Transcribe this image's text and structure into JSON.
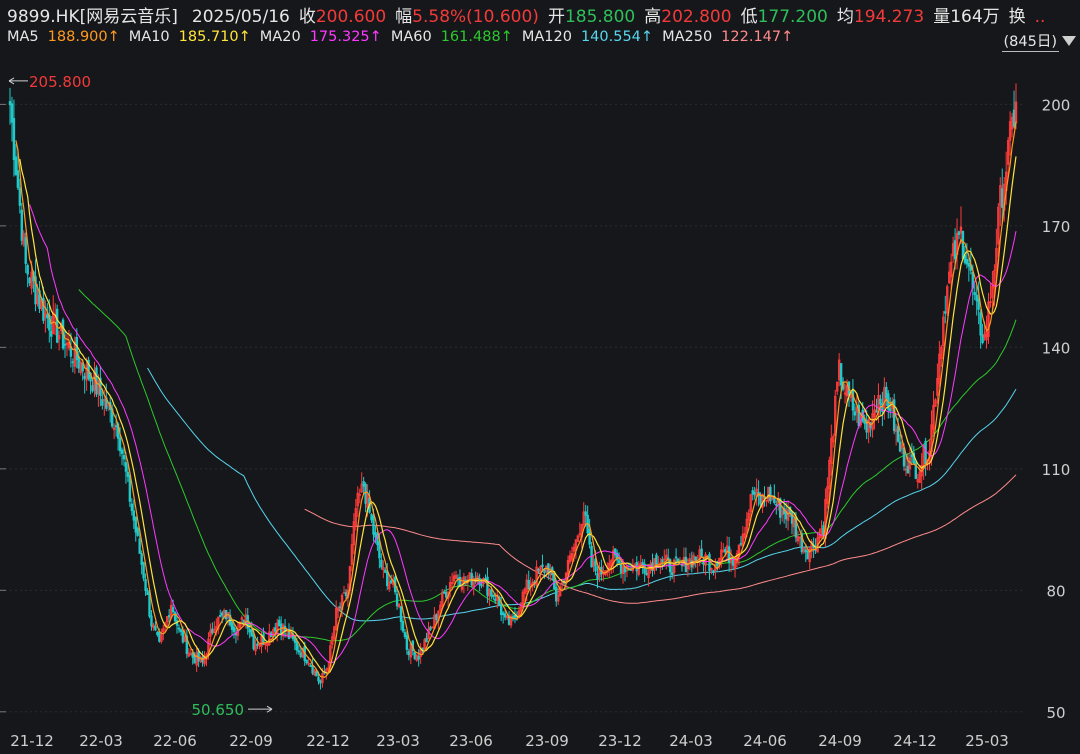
{
  "quote": {
    "symbol": "9899.HK[网易云音乐]",
    "date": "2025/05/16",
    "close_label": "收",
    "close": "200.600",
    "change_label": "幅",
    "change": "5.58%(10.600)",
    "open_label": "开",
    "open": "185.800",
    "high_label": "高",
    "high": "202.800",
    "low_label": "低",
    "low": "177.200",
    "avg_label": "均",
    "avg": "194.273",
    "volume_label": "量",
    "volume": "164万",
    "turnover_label": "换",
    "turnover": ".."
  },
  "ma": [
    {
      "name": "MA5",
      "value": "188.900↑",
      "color": "#ff9a1f"
    },
    {
      "name": "MA10",
      "value": "185.710↑",
      "color": "#ffe43a"
    },
    {
      "name": "MA20",
      "value": "175.325↑",
      "color": "#ff39ff"
    },
    {
      "name": "MA60",
      "value": "161.488↑",
      "color": "#2cc92c"
    },
    {
      "name": "MA120",
      "value": "140.554↑",
      "color": "#57d6ee"
    },
    {
      "name": "MA250",
      "value": "122.147↑",
      "color": "#ff8b8b"
    }
  ],
  "period": "(845日)",
  "chart_data": {
    "type": "candlestick",
    "ylim": [
      46,
      208
    ],
    "y_ticks": [
      50,
      80,
      110,
      140,
      170,
      200
    ],
    "x_ticks": [
      "21-12",
      "22-03",
      "22-06",
      "22-09",
      "22-12",
      "23-03",
      "23-06",
      "23-09",
      "23-12",
      "24-03",
      "24-06",
      "24-09",
      "24-12",
      "25-03"
    ],
    "max_label": "205.800",
    "min_label": "50.650",
    "max_value": 205.8,
    "min_value": 50.65,
    "close_path": [
      [
        0,
        200
      ],
      [
        8,
        160
      ],
      [
        18,
        148
      ],
      [
        30,
        140
      ],
      [
        42,
        132
      ],
      [
        55,
        120
      ],
      [
        62,
        100
      ],
      [
        68,
        84
      ],
      [
        72,
        72
      ],
      [
        76,
        66
      ],
      [
        82,
        77
      ],
      [
        86,
        70
      ],
      [
        92,
        64
      ],
      [
        98,
        62
      ],
      [
        104,
        72
      ],
      [
        110,
        74
      ],
      [
        116,
        70
      ],
      [
        120,
        74
      ],
      [
        124,
        67
      ],
      [
        130,
        68
      ],
      [
        136,
        72
      ],
      [
        140,
        70
      ],
      [
        146,
        66
      ],
      [
        152,
        63
      ],
      [
        158,
        57
      ],
      [
        162,
        62
      ],
      [
        166,
        74
      ],
      [
        172,
        80
      ],
      [
        176,
        100
      ],
      [
        180,
        106
      ],
      [
        186,
        92
      ],
      [
        190,
        84
      ],
      [
        194,
        82
      ],
      [
        198,
        76
      ],
      [
        202,
        66
      ],
      [
        208,
        64
      ],
      [
        214,
        70
      ],
      [
        220,
        78
      ],
      [
        226,
        84
      ],
      [
        232,
        82
      ],
      [
        238,
        84
      ],
      [
        244,
        80
      ],
      [
        248,
        78
      ],
      [
        252,
        72
      ],
      [
        256,
        72
      ],
      [
        262,
        80
      ],
      [
        268,
        84
      ],
      [
        274,
        86
      ],
      [
        278,
        78
      ],
      [
        284,
        86
      ],
      [
        288,
        92
      ],
      [
        292,
        100
      ],
      [
        296,
        86
      ],
      [
        300,
        84
      ],
      [
        306,
        88
      ],
      [
        312,
        86
      ],
      [
        318,
        86
      ],
      [
        324,
        86
      ],
      [
        330,
        88
      ],
      [
        336,
        86
      ],
      [
        342,
        86
      ],
      [
        348,
        88
      ],
      [
        354,
        88
      ],
      [
        358,
        86
      ],
      [
        362,
        90
      ],
      [
        368,
        88
      ],
      [
        374,
        96
      ],
      [
        378,
        104
      ],
      [
        382,
        102
      ],
      [
        386,
        104
      ],
      [
        392,
        100
      ],
      [
        398,
        98
      ],
      [
        402,
        92
      ],
      [
        406,
        90
      ],
      [
        410,
        92
      ],
      [
        414,
        96
      ],
      [
        418,
        116
      ],
      [
        422,
        134
      ],
      [
        426,
        128
      ],
      [
        430,
        124
      ],
      [
        436,
        120
      ],
      [
        442,
        128
      ],
      [
        448,
        126
      ],
      [
        452,
        116
      ],
      [
        456,
        112
      ],
      [
        462,
        110
      ],
      [
        468,
        116
      ],
      [
        472,
        134
      ],
      [
        476,
        152
      ],
      [
        480,
        162
      ],
      [
        484,
        168
      ],
      [
        488,
        160
      ],
      [
        492,
        148
      ],
      [
        496,
        142
      ],
      [
        500,
        156
      ],
      [
        504,
        176
      ],
      [
        508,
        188
      ],
      [
        512,
        200.6
      ]
    ]
  }
}
